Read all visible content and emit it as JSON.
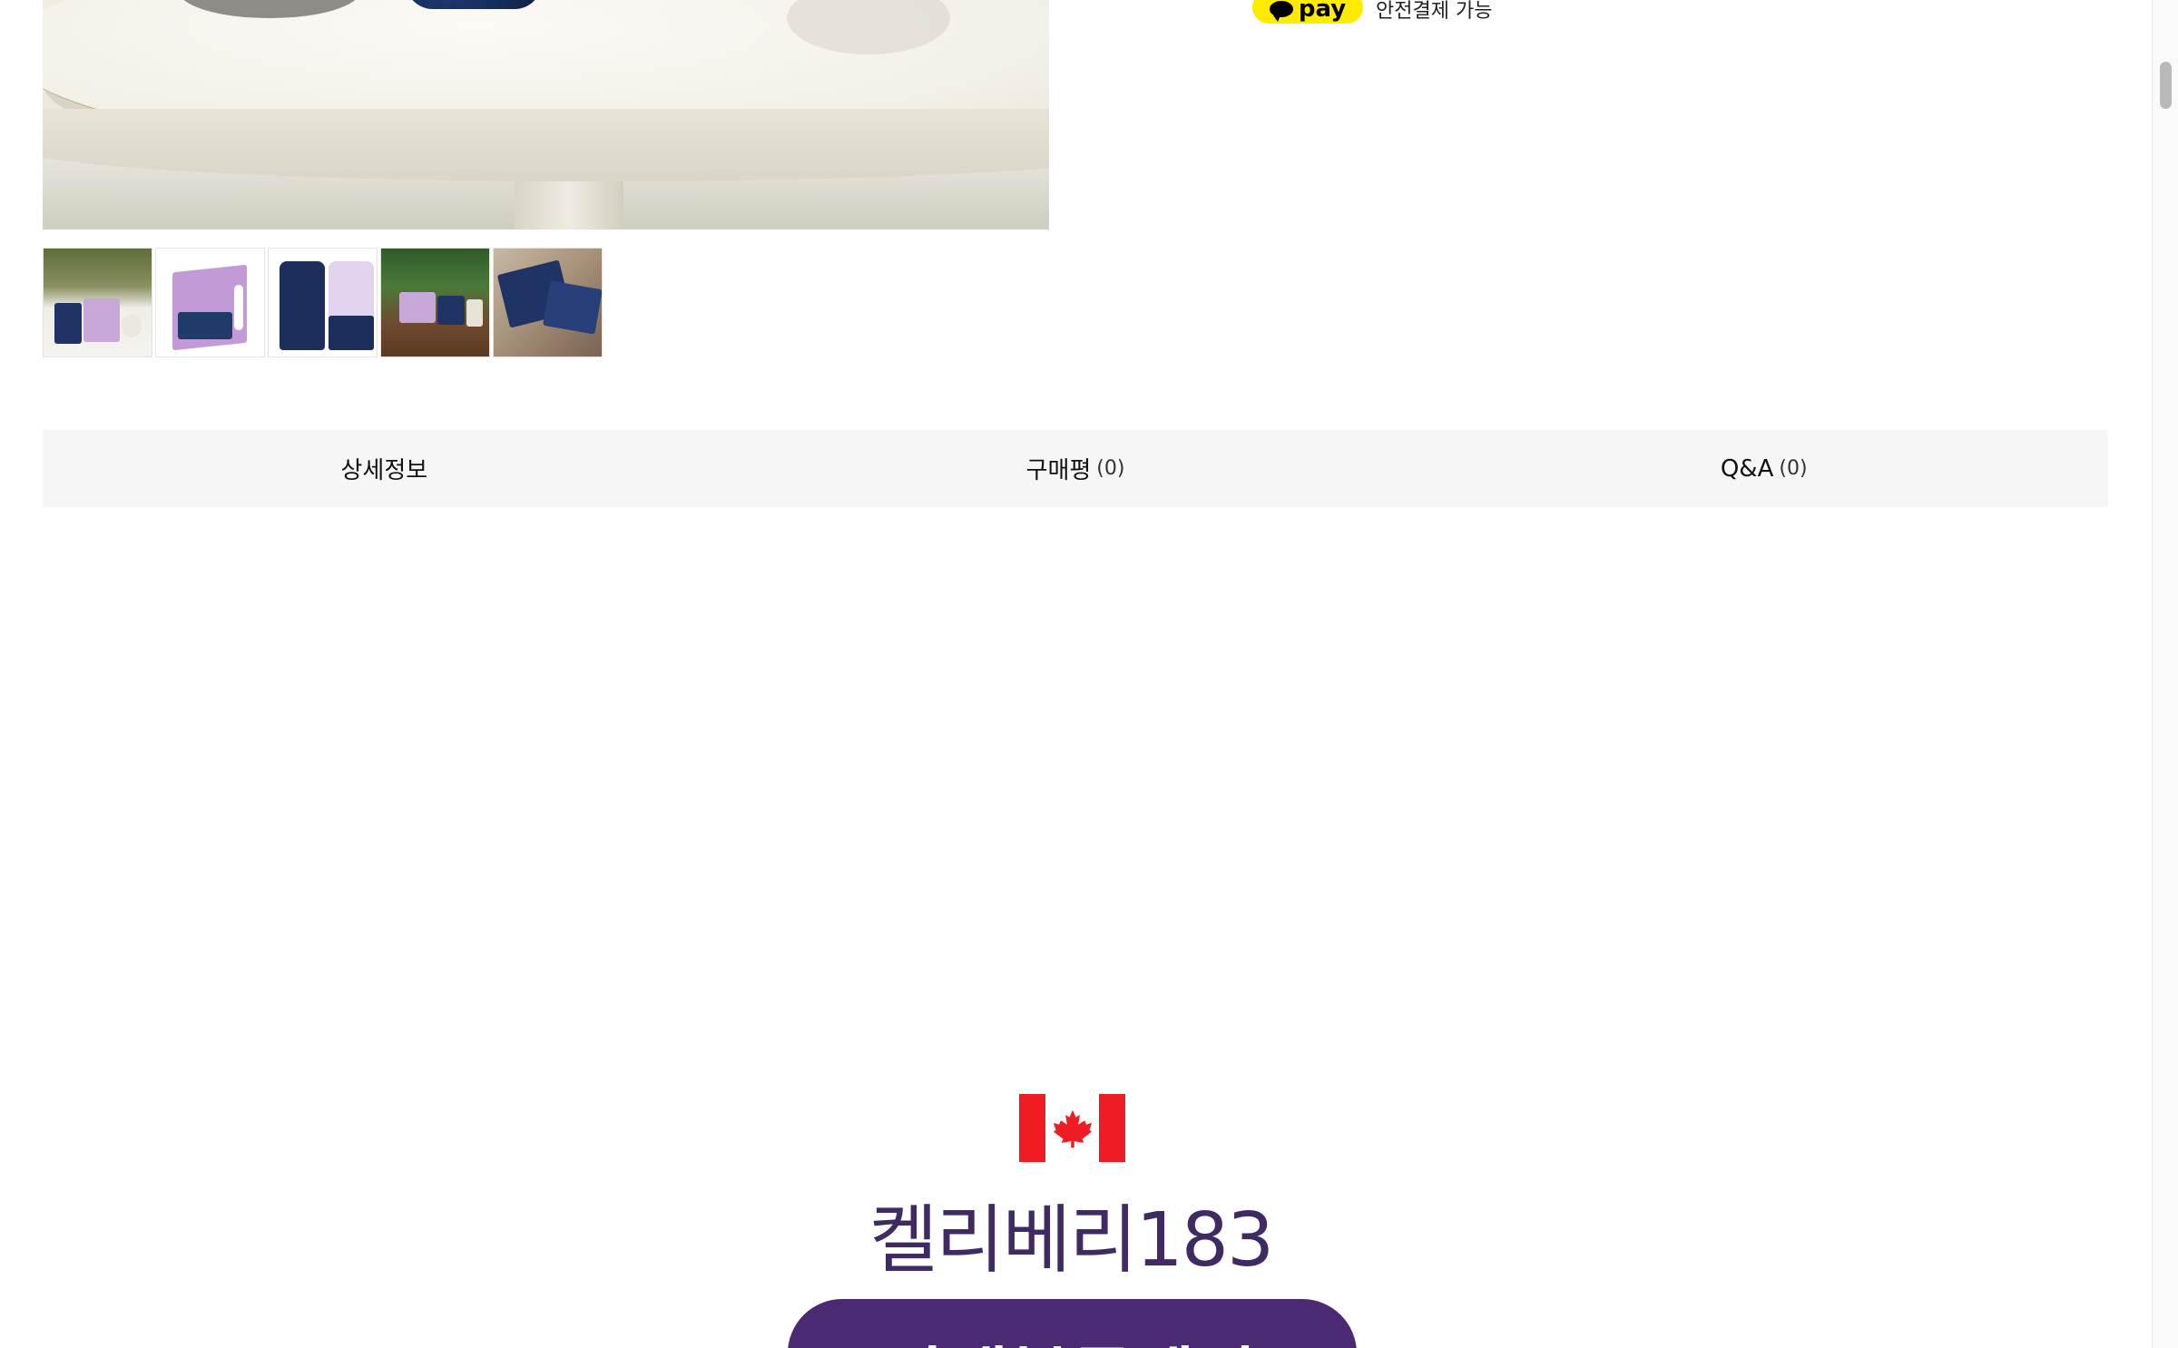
{
  "payment": {
    "badge_text": "pay",
    "label": "안전결제 가능",
    "badge_color": "#ffeb00"
  },
  "gallery": {
    "thumbnails": [
      {
        "name": "thumbnail-1"
      },
      {
        "name": "thumbnail-2"
      },
      {
        "name": "thumbnail-3"
      },
      {
        "name": "thumbnail-4"
      },
      {
        "name": "thumbnail-5"
      }
    ]
  },
  "tabs": [
    {
      "label": "상세정보",
      "count": ""
    },
    {
      "label": "구매평",
      "count": "(0)"
    },
    {
      "label": "Q&A",
      "count": "(0)"
    }
  ],
  "detail": {
    "flag_icon": "canada-flag-icon",
    "brand_title": "켈리베리183",
    "banner_text": "야생블루베리"
  },
  "colors": {
    "brand_purple": "#3f2a64",
    "banner_purple": "#4a2a72",
    "flag_red": "#ee1c25",
    "tab_background": "#f6f6f6"
  }
}
